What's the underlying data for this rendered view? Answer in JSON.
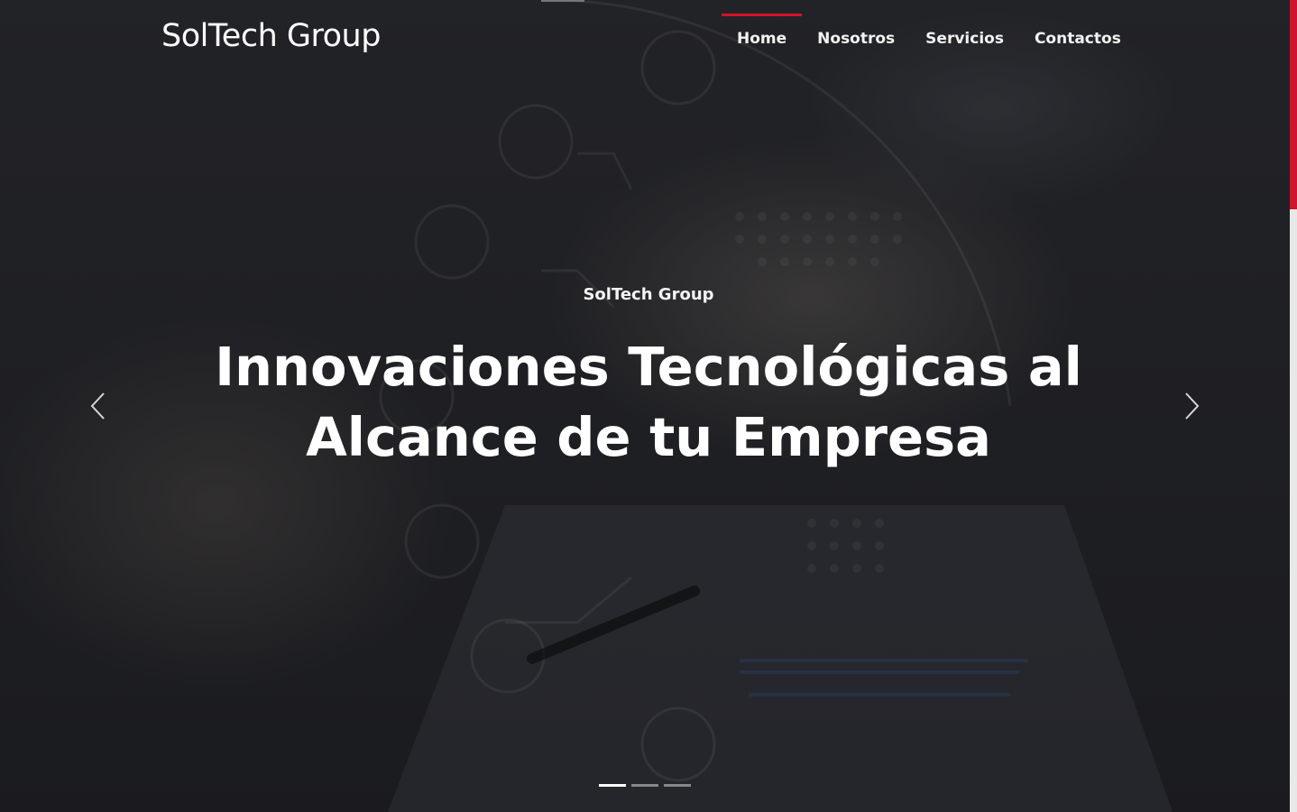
{
  "brand": "SolTech Group",
  "nav": [
    {
      "label": "Home",
      "active": true
    },
    {
      "label": "Nosotros",
      "active": false
    },
    {
      "label": "Servicios",
      "active": false
    },
    {
      "label": "Contactos",
      "active": false
    }
  ],
  "hero": {
    "eyebrow": "SolTech Group",
    "headline_line1": "Innovaciones Tecnológicas al",
    "headline_line2": "Alcance de tu Empresa"
  },
  "carousel": {
    "slide_count": 3,
    "active_index": 0,
    "prev_icon": "chevron-left-icon",
    "next_icon": "chevron-right-icon"
  },
  "colors": {
    "accent": "#d0142a",
    "overlay": "#26272b",
    "text": "#ffffff"
  }
}
